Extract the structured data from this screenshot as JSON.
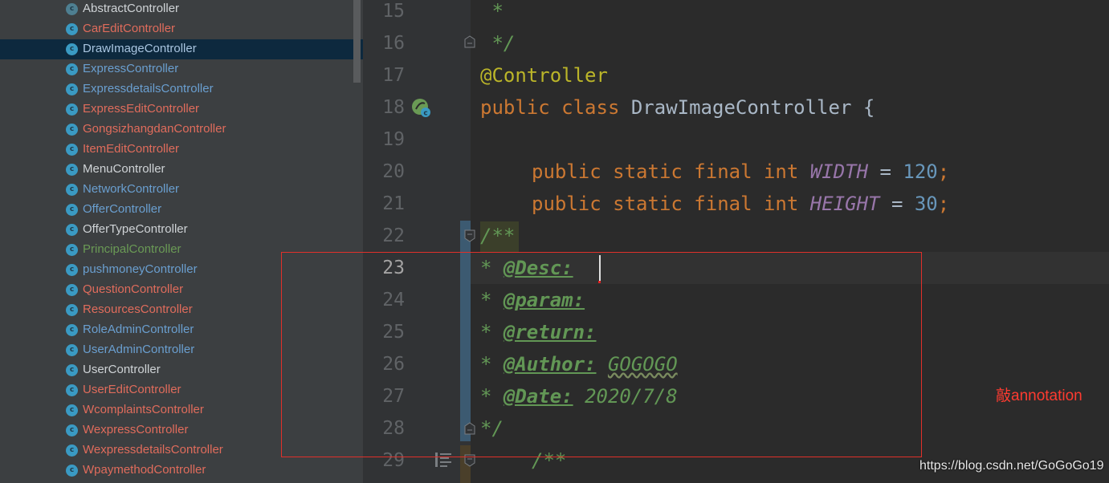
{
  "project_tree": {
    "items": [
      {
        "name": "AbstractController",
        "color": "#cfd3d6",
        "icon": "abstract-class-icon"
      },
      {
        "name": "CarEditController",
        "color": "#e06c5c",
        "icon": "class-icon"
      },
      {
        "name": "DrawImageController",
        "color": "#a9c5e0",
        "icon": "class-icon",
        "selected": true
      },
      {
        "name": "ExpressController",
        "color": "#6a9fd0",
        "icon": "class-icon"
      },
      {
        "name": "ExpressdetailsController",
        "color": "#6a9fd0",
        "icon": "class-icon"
      },
      {
        "name": "ExpressEditController",
        "color": "#e06c5c",
        "icon": "class-icon"
      },
      {
        "name": "GongsizhangdanController",
        "color": "#e06c5c",
        "icon": "class-icon"
      },
      {
        "name": "ItemEditController",
        "color": "#e06c5c",
        "icon": "class-icon"
      },
      {
        "name": "MenuController",
        "color": "#cfd3d6",
        "icon": "class-icon"
      },
      {
        "name": "NetworkController",
        "color": "#6a9fd0",
        "icon": "class-icon"
      },
      {
        "name": "OfferController",
        "color": "#6a9fd0",
        "icon": "class-icon"
      },
      {
        "name": "OfferTypeController",
        "color": "#cfd3d6",
        "icon": "class-icon"
      },
      {
        "name": "PrincipalController",
        "color": "#6a9a55",
        "icon": "class-icon"
      },
      {
        "name": "pushmoneyController",
        "color": "#6a9fd0",
        "icon": "class-icon"
      },
      {
        "name": "QuestionController",
        "color": "#e06c5c",
        "icon": "class-icon"
      },
      {
        "name": "ResourcesController",
        "color": "#e06c5c",
        "icon": "class-icon"
      },
      {
        "name": "RoleAdminController",
        "color": "#6a9fd0",
        "icon": "class-icon"
      },
      {
        "name": "UserAdminController",
        "color": "#6a9fd0",
        "icon": "class-icon"
      },
      {
        "name": "UserController",
        "color": "#cfd3d6",
        "icon": "class-icon"
      },
      {
        "name": "UserEditController",
        "color": "#e06c5c",
        "icon": "class-icon"
      },
      {
        "name": "WcomplaintsController",
        "color": "#e06c5c",
        "icon": "class-icon"
      },
      {
        "name": "WexpressController",
        "color": "#e06c5c",
        "icon": "class-icon"
      },
      {
        "name": "WexpressdetailsController",
        "color": "#e06c5c",
        "icon": "class-icon"
      },
      {
        "name": "WpaymethodController",
        "color": "#e06c5c",
        "icon": "class-icon"
      }
    ]
  },
  "editor": {
    "line_numbers": [
      "15",
      "16",
      "17",
      "18",
      "19",
      "20",
      "21",
      "22",
      "23",
      "24",
      "25",
      "26",
      "27",
      "28",
      "29"
    ],
    "current_line": "23",
    "code": {
      "l15": " *",
      "l16": " */",
      "l17_ann": "@Controller",
      "l18_kw1": "public",
      "l18_kw2": "class",
      "l18_name": "DrawImageController",
      "l18_brace": "{",
      "l20_mods": "public static final int",
      "l20_const": "WIDTH",
      "l20_eq": "=",
      "l20_num": "120",
      "l20_semi": ";",
      "l21_mods": "public static final int",
      "l21_const": "HEIGHT",
      "l21_eq": "=",
      "l21_num": "30",
      "l21_semi": ";",
      "l22": "/**",
      "l23_star": "* ",
      "l23_tag": "@Desc:",
      "l24_star": "* ",
      "l24_tag": "@param:",
      "l25_star": "* ",
      "l25_tag": "@return:",
      "l26_star": "* ",
      "l26_tag": "@Author:",
      "l26_val": "GOGOGO",
      "l27_star": "* ",
      "l27_tag": "@Date:",
      "l27_val": "2020/7/8",
      "l28": "*/",
      "l29": "/**"
    }
  },
  "annotation": {
    "note": "敲annotation",
    "box_color": "#e0302a"
  },
  "watermark": "https://blog.csdn.net/GoGoGo19"
}
